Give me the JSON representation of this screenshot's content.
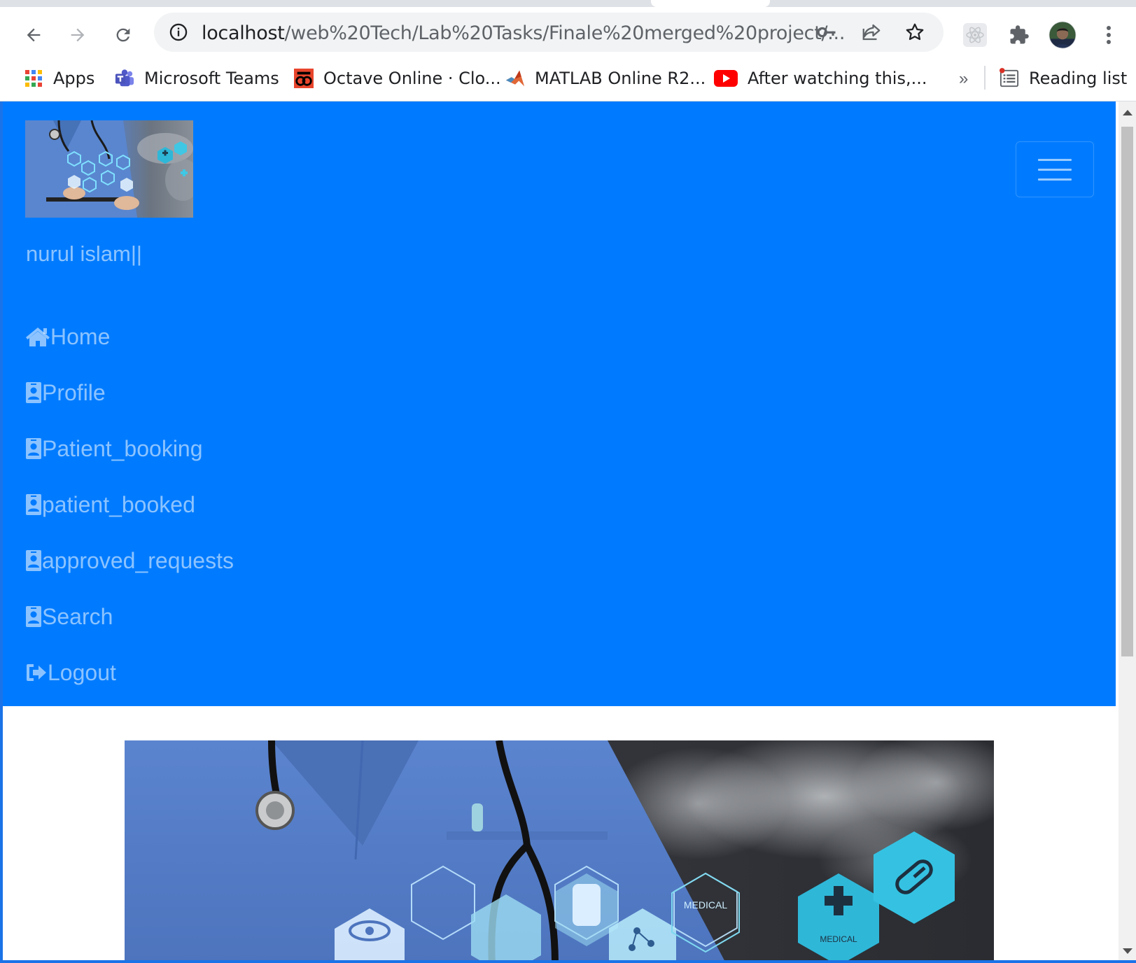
{
  "browser": {
    "url_host": "localhost",
    "url_path": "/web%20Tech/Lab%20Tasks/Finale%20merged%20project/...",
    "bookmarks": [
      {
        "label": "Apps",
        "icon": "apps-grid-icon"
      },
      {
        "label": "Microsoft Teams",
        "icon": "teams-icon"
      },
      {
        "label": "Octave Online · Clo...",
        "icon": "octave-icon"
      },
      {
        "label": "MATLAB Online R2...",
        "icon": "matlab-icon"
      },
      {
        "label": "After watching this,...",
        "icon": "youtube-icon"
      }
    ],
    "overflow_chevron": "»",
    "reading_list": "Reading list"
  },
  "navbar": {
    "brand_text": "nurul islam||",
    "background_color": "#007bff",
    "items": [
      {
        "label": "Home",
        "icon": "home-icon"
      },
      {
        "label": "Profile",
        "icon": "id-badge-icon"
      },
      {
        "label": "Patient_booking",
        "icon": "id-badge-icon"
      },
      {
        "label": "patient_booked",
        "icon": "id-badge-icon"
      },
      {
        "label": "approved_requests",
        "icon": "id-badge-icon"
      },
      {
        "label": "Search",
        "icon": "id-badge-icon"
      },
      {
        "label": "Logout",
        "icon": "sign-out-icon"
      }
    ]
  },
  "hero": {
    "labels": [
      "MEDICAL",
      "MEDICAL"
    ]
  }
}
